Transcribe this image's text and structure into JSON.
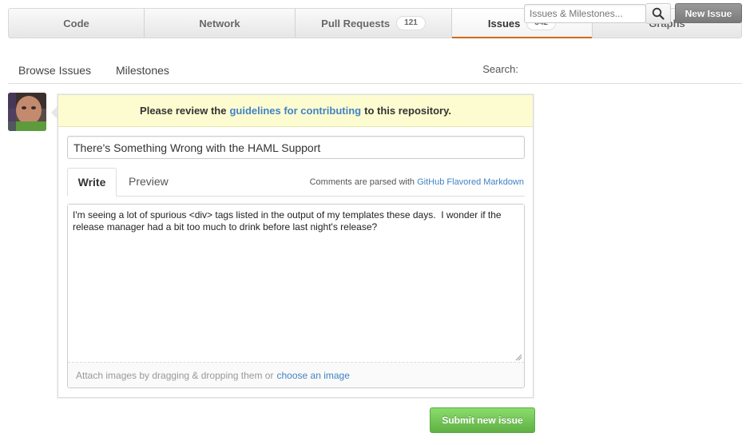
{
  "tabs": [
    {
      "label": "Code"
    },
    {
      "label": "Network"
    },
    {
      "label": "Pull Requests",
      "count": "121"
    },
    {
      "label": "Issues",
      "count": "342",
      "active": true
    },
    {
      "label": "Graphs"
    }
  ],
  "subnav": {
    "browse_label": "Browse Issues",
    "milestones_label": "Milestones",
    "search_label": "Search:",
    "search_placeholder": "Issues & Milestones...",
    "search_icon": "magnifier-icon",
    "new_issue_label": "New Issue"
  },
  "form": {
    "guidelines_prefix": "Please review the",
    "guidelines_link": "guidelines for contributing",
    "guidelines_suffix": "to this repository.",
    "title_value": "There's Something Wrong with the HAML Support",
    "write_tab": "Write",
    "preview_tab": "Preview",
    "md_note_prefix": "Comments are parsed with",
    "md_note_link": "GitHub Flavored Markdown",
    "body_value": "I'm seeing a lot of spurious <div> tags listed in the output of my templates these days.  I wonder if the release manager had a bit too much to drink before last night's release?",
    "attach_prefix": "Attach images by dragging & dropping them or",
    "attach_link": "choose an image",
    "submit_label": "Submit new issue"
  },
  "colors": {
    "accent_orange": "#d26911",
    "link_blue": "#4183c4",
    "submit_green": "#60b044",
    "notice_yellow": "#fdfcd1"
  }
}
